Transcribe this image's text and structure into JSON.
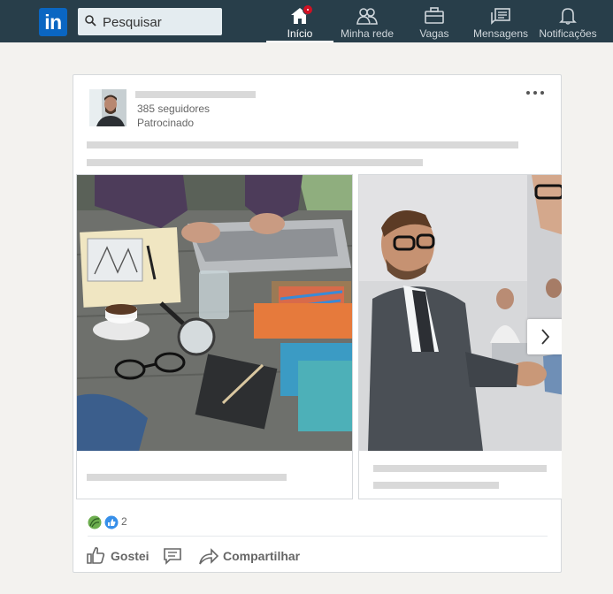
{
  "nav": {
    "logo_text": "in",
    "search_placeholder": "Pesquisar",
    "items": [
      {
        "label": "Início",
        "icon": "home-icon",
        "active": true,
        "has_notification": true
      },
      {
        "label": "Minha rede",
        "icon": "network-icon"
      },
      {
        "label": "Vagas",
        "icon": "briefcase-icon"
      },
      {
        "label": "Mensagens",
        "icon": "messages-icon"
      },
      {
        "label": "Notificações",
        "icon": "bell-icon"
      }
    ]
  },
  "post": {
    "followers": "385 seguidores",
    "promoted": "Patrocinado",
    "reaction_count": "2",
    "actions": {
      "like": "Gostei",
      "comment": "",
      "share": "Compartilhar"
    }
  },
  "colors": {
    "nav_bg": "#283e4a",
    "brand": "#0a66c2",
    "notification": "#d11124"
  }
}
